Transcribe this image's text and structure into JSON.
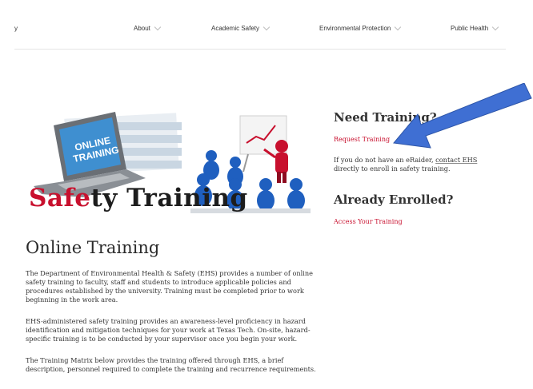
{
  "nav": {
    "edge_text": "y",
    "items": [
      {
        "label": "About"
      },
      {
        "label": "Academic Safety"
      },
      {
        "label": "Environmental Protection"
      },
      {
        "label": "Public Health"
      }
    ]
  },
  "hero": {
    "laptop_text_line1": "ONLINE",
    "laptop_text_line2": "TRAINING",
    "title_red": "Safe",
    "title_dark": "ty Training"
  },
  "main": {
    "heading": "Online Training",
    "paragraphs": [
      "The Department of Environmental Health & Safety (EHS) provides a number of online safety training to faculty, staff and students to introduce applicable policies and procedures established by the university. Training must be completed prior to work beginning in the work area.",
      "EHS-administered safety training provides an awareness-level proficiency in hazard identification and mitigation techniques for your work at Texas Tech. On-site, hazard-specific training is to be conducted by your supervisor once you begin your work.",
      "The Training Matrix below provides the training offered through EHS, a brief description, personnel required to complete the training and recurrence requirements."
    ]
  },
  "sidebar": {
    "need_heading": "Need Training?",
    "request_link": "Request Training",
    "info_prefix": "If you do not have an eRaider, ",
    "info_link": "contact EHS",
    "info_suffix": " directly to enroll in safety training.",
    "enrolled_heading": "Already Enrolled?",
    "access_link": "Access Your Training"
  },
  "colors": {
    "brand_red": "#c8102e",
    "annotation_arrow": "#3f6fd3",
    "figure_blue": "#1f5fbf"
  }
}
